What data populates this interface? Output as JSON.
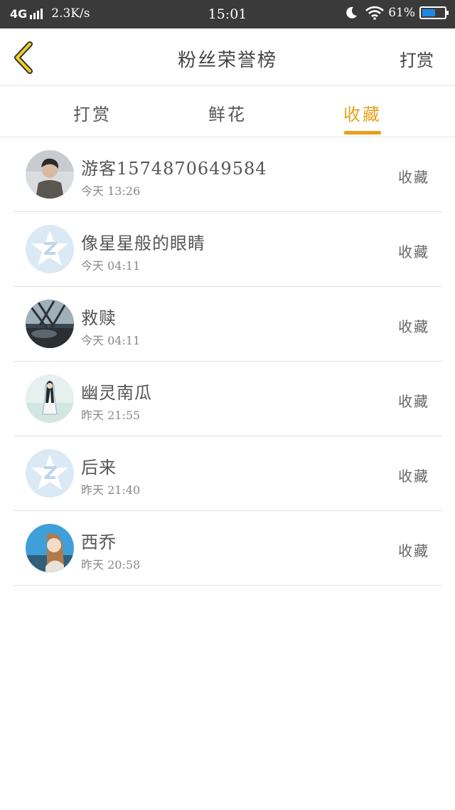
{
  "status_bar": {
    "network": "4G",
    "speed": "2.3K/s",
    "time": "15:01",
    "battery_text": "61%",
    "battery_level": 0.61
  },
  "nav": {
    "title": "粉丝荣誉榜",
    "action_label": "打赏"
  },
  "tabs": [
    {
      "label": "打赏",
      "active": false
    },
    {
      "label": "鲜花",
      "active": false
    },
    {
      "label": "收藏",
      "active": true
    }
  ],
  "accent_color": "#e6a11a",
  "rows": [
    {
      "name": "游客1574870649584",
      "time": "今天 13:26",
      "tag": "收藏",
      "avatar": "photo-person"
    },
    {
      "name": "像星星般的眼睛",
      "time": "今天 04:11",
      "tag": "收藏",
      "avatar": "default-star"
    },
    {
      "name": "救赎",
      "time": "今天 04:11",
      "tag": "收藏",
      "avatar": "photo-scene"
    },
    {
      "name": "幽灵南瓜",
      "time": "昨天 21:55",
      "tag": "收藏",
      "avatar": "photo-snow"
    },
    {
      "name": "后来",
      "time": "昨天 21:40",
      "tag": "收藏",
      "avatar": "default-star"
    },
    {
      "name": "西乔",
      "time": "昨天 20:58",
      "tag": "收藏",
      "avatar": "photo-anime"
    }
  ]
}
